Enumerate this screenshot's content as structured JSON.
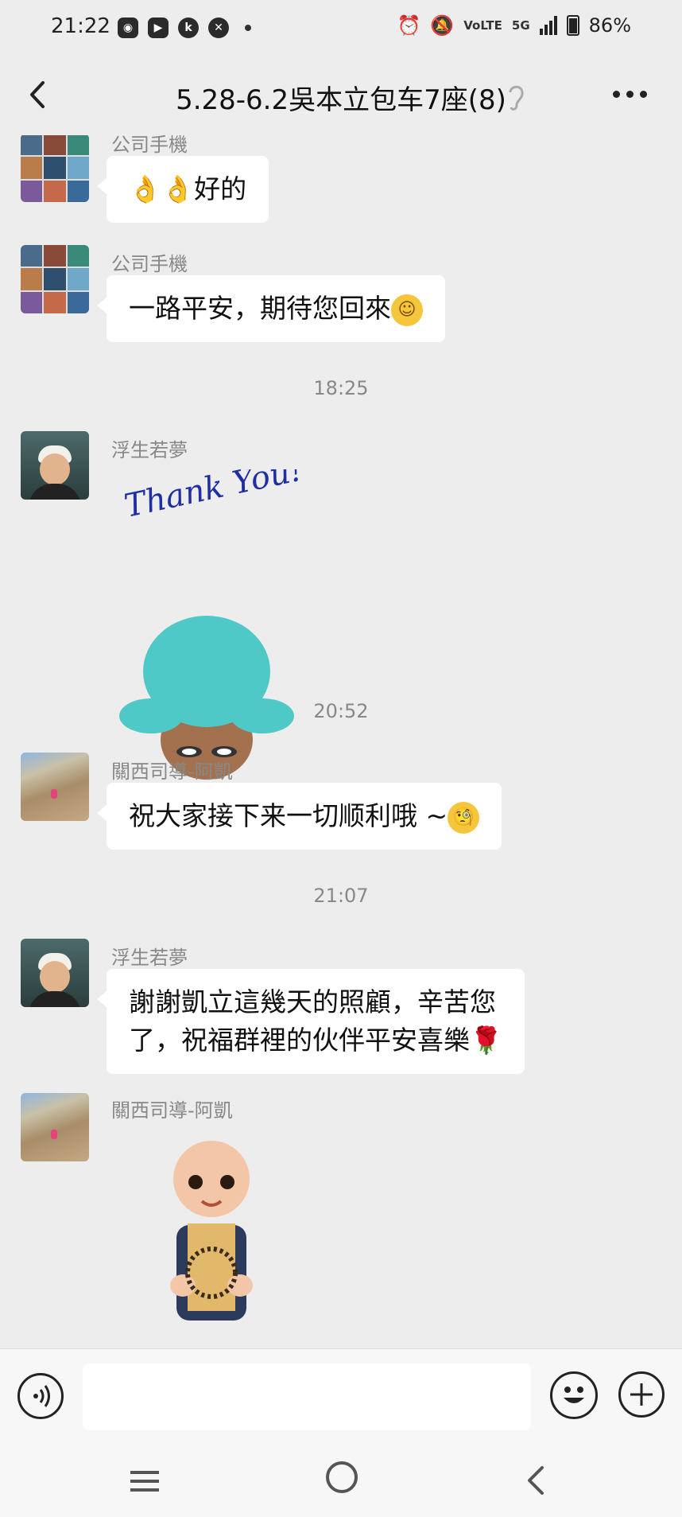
{
  "status_bar": {
    "time": "21:22",
    "network": "5G",
    "volte": "VoLTE",
    "battery": "86%"
  },
  "header": {
    "title": "5.28-6.2吳本立包车7座(8)"
  },
  "messages": [
    {
      "sender": "公司手機",
      "text": "👌👌好的"
    },
    {
      "sender": "公司手機",
      "text": "一路平安，期待您回來",
      "emoji": "☺"
    },
    {
      "time": "18:25"
    },
    {
      "sender": "浮生若夢",
      "sticker_text": "Thank You!"
    },
    {
      "time": "20:52"
    },
    {
      "sender": "關西司導-阿凱",
      "text": "祝大家接下来一切顺利哦 ~",
      "emoji": "🧐"
    },
    {
      "time": "21:07"
    },
    {
      "sender": "浮生若夢",
      "text_line1": "謝謝凱立這幾天的照顧，辛苦您",
      "text_line2": "了，祝福群裡的伙伴平安喜樂🌹"
    },
    {
      "sender": "關西司導-阿凱"
    }
  ],
  "input": {
    "placeholder": ""
  },
  "colors": {
    "background": "#ededed",
    "bubble": "#ffffff",
    "meta_text": "#888888"
  }
}
